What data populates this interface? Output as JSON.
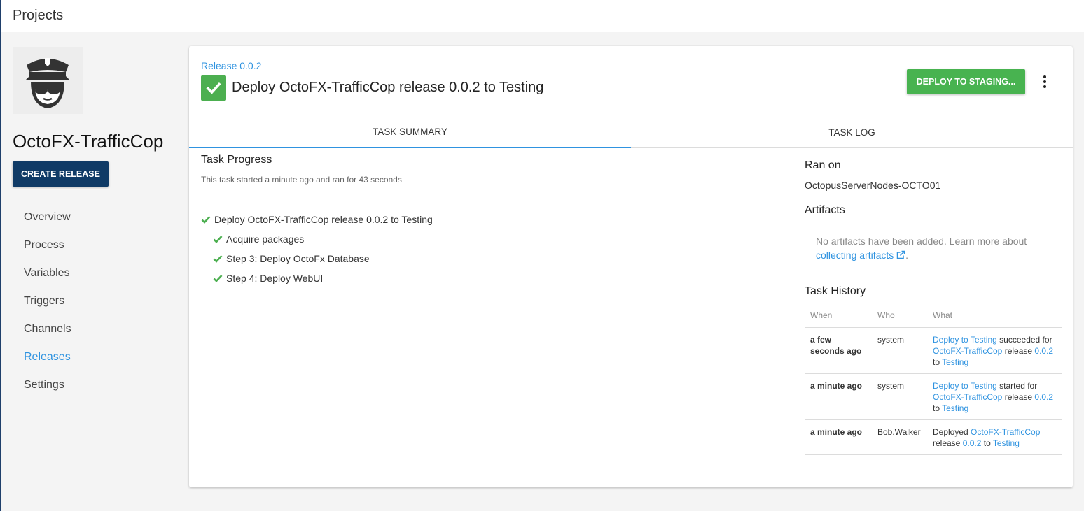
{
  "header": {
    "title": "Projects"
  },
  "sidebar": {
    "project_name": "OctoFX-TrafficCop",
    "create_release_label": "CREATE RELEASE",
    "logo_icon": "police-officer-icon",
    "nav": [
      {
        "label": "Overview"
      },
      {
        "label": "Process"
      },
      {
        "label": "Variables"
      },
      {
        "label": "Triggers"
      },
      {
        "label": "Channels"
      },
      {
        "label": "Releases",
        "active": true
      },
      {
        "label": "Settings"
      }
    ]
  },
  "task": {
    "release_link": "Release 0.0.2",
    "title": "Deploy OctoFX-TrafficCop release 0.0.2 to Testing",
    "status_icon": "check-icon",
    "status_color": "#4caf50",
    "deploy_button_label": "DEPLOY TO STAGING...",
    "menu_icon": "more-vertical-icon"
  },
  "tabs": [
    {
      "label": "TASK SUMMARY",
      "active": true
    },
    {
      "label": "TASK LOG",
      "active": false
    }
  ],
  "progress": {
    "heading": "Task Progress",
    "sub_prefix": "This task started ",
    "sub_time": "a minute ago",
    "sub_suffix": " and ran for 43 seconds",
    "steps": [
      {
        "label": "Deploy OctoFX-TrafficCop release 0.0.2 to Testing"
      },
      {
        "label": "Acquire packages"
      },
      {
        "label": "Step 3: Deploy OctoFx Database"
      },
      {
        "label": "Step 4: Deploy WebUI"
      }
    ]
  },
  "details": {
    "ran_on_heading": "Ran on",
    "ran_on_value": "OctopusServerNodes-OCTO01",
    "artifacts_heading": "Artifacts",
    "artifacts_text": "No artifacts have been added. Learn more about ",
    "artifacts_link": "collecting artifacts",
    "artifacts_period": ".",
    "history_heading": "Task History",
    "history_columns": [
      "When",
      "Who",
      "What"
    ],
    "history": [
      {
        "when": "a few seconds ago",
        "who": "system",
        "p1": "Deploy to Testing",
        "t1": " succeeded for ",
        "p2": "OctoFX-TrafficCop",
        "t2": " release ",
        "p3": "0.0.2",
        "t3": " to ",
        "p4": "Testing"
      },
      {
        "when": "a minute ago",
        "who": "system",
        "p1": "Deploy to Testing",
        "t1": " started for ",
        "p2": "OctoFX-TrafficCop",
        "t2": " release ",
        "p3": "0.0.2",
        "t3": " to ",
        "p4": "Testing"
      },
      {
        "when": "a minute ago",
        "who": "Bob.Walker",
        "t0": "Deployed ",
        "p2": "OctoFX-TrafficCop",
        "t2": " release ",
        "p3": "0.0.2",
        "t3": " to ",
        "p4": "Testing"
      }
    ]
  },
  "colors": {
    "accent": "#2f93e0",
    "primary_button": "#0f3a66",
    "success": "#48b350"
  }
}
